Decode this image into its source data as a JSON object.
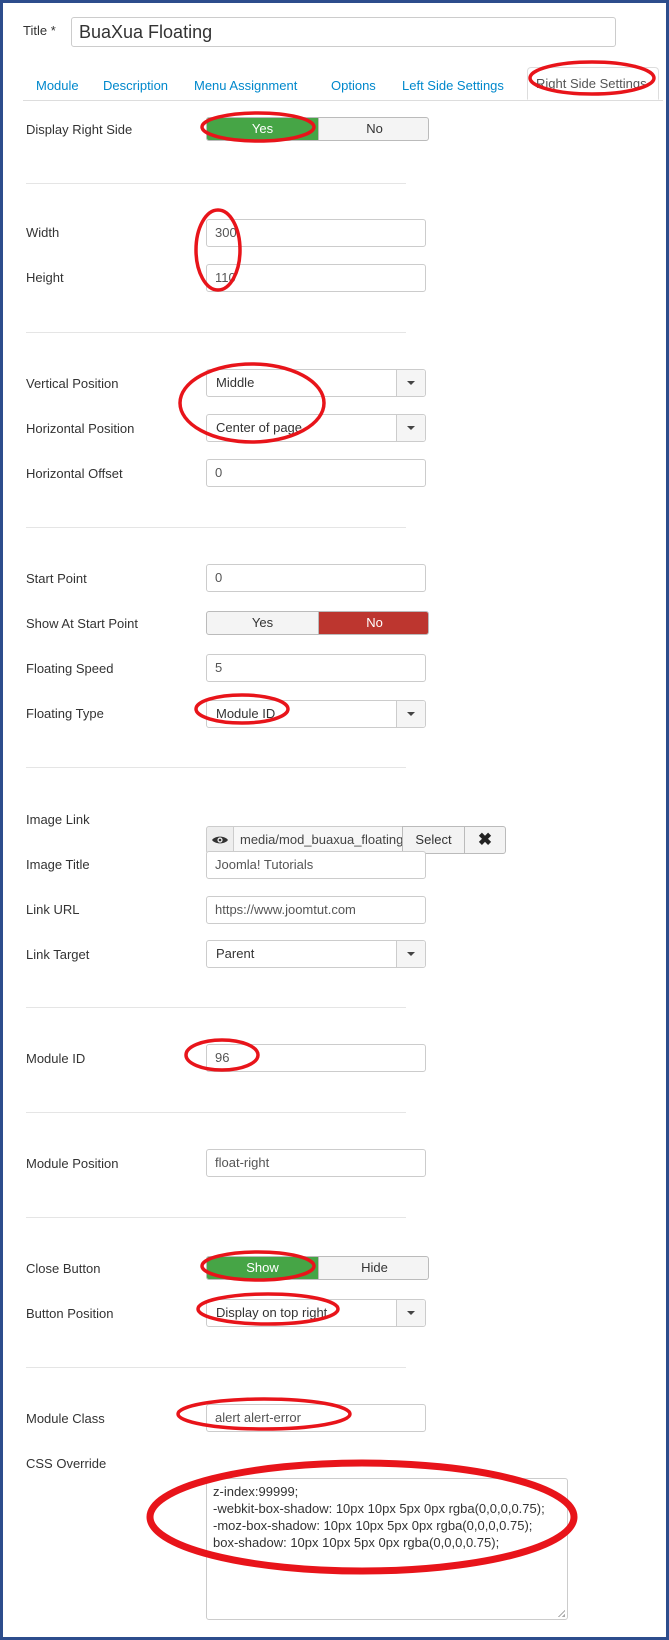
{
  "title": {
    "label": "Title *",
    "value": "BuaXua Floating"
  },
  "tabs": [
    "Module",
    "Description",
    "Menu Assignment",
    "Options",
    "Left Side Settings",
    "Right Side Settings"
  ],
  "toggle_yes": "Yes",
  "toggle_no": "No",
  "fields": {
    "display_right_side": {
      "label": "Display Right Side",
      "selected": "Yes"
    },
    "width": {
      "label": "Width",
      "value": "300"
    },
    "height": {
      "label": "Height",
      "value": "110"
    },
    "vertical_position": {
      "label": "Vertical Position",
      "value": "Middle"
    },
    "horizontal_position": {
      "label": "Horizontal Position",
      "value": "Center of page"
    },
    "horizontal_offset": {
      "label": "Horizontal Offset",
      "value": "0"
    },
    "start_point": {
      "label": "Start Point",
      "value": "0"
    },
    "show_at_start_point": {
      "label": "Show At Start Point",
      "selected": "No"
    },
    "floating_speed": {
      "label": "Floating Speed",
      "value": "5"
    },
    "floating_type": {
      "label": "Floating Type",
      "value": "Module ID"
    },
    "image_link": {
      "label": "Image Link",
      "value": "media/mod_buaxua_floating",
      "select_label": "Select",
      "clear_label": "✖"
    },
    "image_title": {
      "label": "Image Title",
      "value": "Joomla! Tutorials"
    },
    "link_url": {
      "label": "Link URL",
      "value": "https://www.joomtut.com"
    },
    "link_target": {
      "label": "Link Target",
      "value": "Parent"
    },
    "module_id": {
      "label": "Module ID",
      "value": "96"
    },
    "module_position": {
      "label": "Module Position",
      "value": "float-right"
    },
    "close_button": {
      "label": "Close Button",
      "show_label": "Show",
      "hide_label": "Hide",
      "selected": "Show"
    },
    "button_position": {
      "label": "Button Position",
      "value": "Display on top right"
    },
    "module_class": {
      "label": "Module Class",
      "value": "alert alert-error"
    },
    "css_override": {
      "label": "CSS Override",
      "lines": [
        "z-index:99999;",
        "-webkit-box-shadow: 10px 10px 5px 0px rgba(0,0,0,0.75);",
        "-moz-box-shadow: 10px 10px 5px 0px rgba(0,0,0,0.75);",
        "box-shadow: 10px 10px 5px 0px rgba(0,0,0,0.75);"
      ]
    }
  },
  "colors": {
    "active_green": "#46a546",
    "active_red": "#bd362f",
    "annotation_red": "#e8141a",
    "frame_blue": "#2d4d8c",
    "link_blue": "#0088cc"
  }
}
